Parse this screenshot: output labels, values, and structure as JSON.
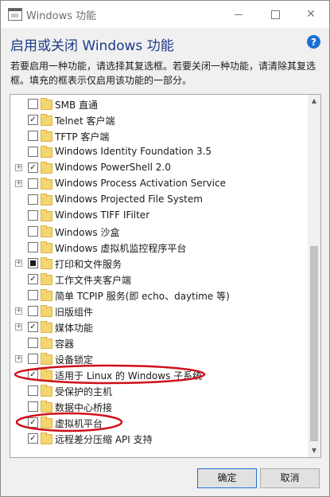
{
  "window": {
    "title": "Windows 功能"
  },
  "header": {
    "title": "启用或关闭 Windows 功能",
    "description": "若要启用一种功能，请选择其复选框。若要关闭一种功能，请清除其复选框。填充的框表示仅启用该功能的一部分。"
  },
  "features": [
    {
      "label": "SMB 直通",
      "expandable": false,
      "state": "unchecked"
    },
    {
      "label": "Telnet 客户端",
      "expandable": false,
      "state": "checked"
    },
    {
      "label": "TFTP 客户端",
      "expandable": false,
      "state": "unchecked"
    },
    {
      "label": "Windows Identity Foundation 3.5",
      "expandable": false,
      "state": "unchecked"
    },
    {
      "label": "Windows PowerShell 2.0",
      "expandable": true,
      "state": "checked"
    },
    {
      "label": "Windows Process Activation Service",
      "expandable": true,
      "state": "unchecked"
    },
    {
      "label": "Windows Projected File System",
      "expandable": false,
      "state": "unchecked"
    },
    {
      "label": "Windows TIFF IFilter",
      "expandable": false,
      "state": "unchecked"
    },
    {
      "label": "Windows 沙盒",
      "expandable": false,
      "state": "unchecked"
    },
    {
      "label": "Windows 虚拟机监控程序平台",
      "expandable": false,
      "state": "unchecked"
    },
    {
      "label": "打印和文件服务",
      "expandable": true,
      "state": "partial"
    },
    {
      "label": "工作文件夹客户端",
      "expandable": false,
      "state": "checked"
    },
    {
      "label": "简单 TCPIP 服务(即 echo、daytime 等)",
      "expandable": false,
      "state": "unchecked"
    },
    {
      "label": "旧版组件",
      "expandable": true,
      "state": "unchecked"
    },
    {
      "label": "媒体功能",
      "expandable": true,
      "state": "checked"
    },
    {
      "label": "容器",
      "expandable": false,
      "state": "unchecked"
    },
    {
      "label": "设备锁定",
      "expandable": true,
      "state": "unchecked"
    },
    {
      "label": "适用于 Linux 的 Windows 子系统",
      "expandable": false,
      "state": "checked"
    },
    {
      "label": "受保护的主机",
      "expandable": false,
      "state": "unchecked"
    },
    {
      "label": "数据中心桥接",
      "expandable": false,
      "state": "unchecked"
    },
    {
      "label": "虚拟机平台",
      "expandable": false,
      "state": "checked"
    },
    {
      "label": "远程差分压缩 API 支持",
      "expandable": false,
      "state": "checked"
    }
  ],
  "buttons": {
    "ok": "确定",
    "cancel": "取消"
  },
  "help_icon": "?",
  "annotation_color": "#d0101a"
}
